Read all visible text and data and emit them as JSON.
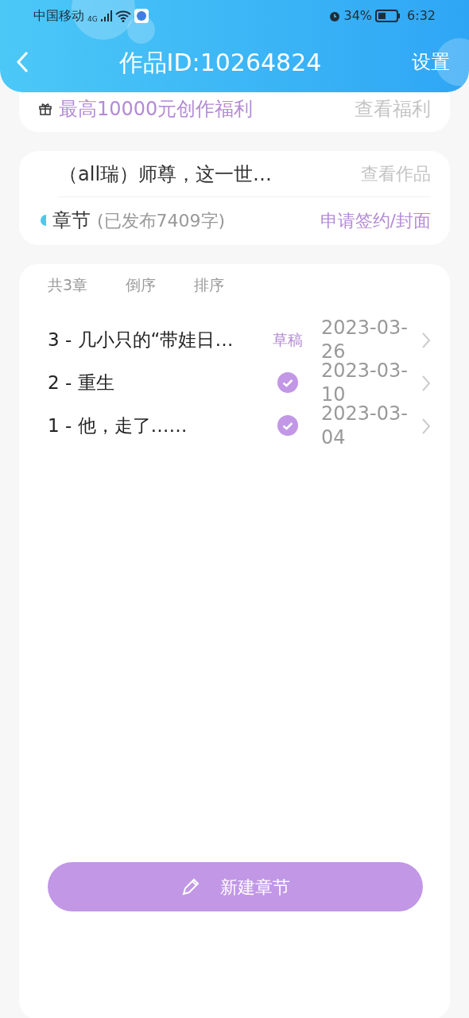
{
  "status_bar": {
    "carrier": "中国移动",
    "network": "4G",
    "battery": "34%",
    "time": "6:32"
  },
  "header": {
    "title": "作品ID:10264824",
    "action": "设置"
  },
  "benefit": {
    "text": "最高10000元创作福利",
    "link": "查看福利"
  },
  "work": {
    "title": "（all瑞）师尊，这一世…",
    "link": "查看作品",
    "section": "章节",
    "section_note": "(已发布7409字)",
    "apply": "申请签约/封面"
  },
  "toolbar": {
    "count": "共3章",
    "reverse": "倒序",
    "sort": "排序"
  },
  "chapters": [
    {
      "title": "3 - 几小只的“带娃日…",
      "kind": "draft",
      "status": "草稿",
      "date": "2023-03-26"
    },
    {
      "title": "2 - 重生",
      "kind": "published",
      "date": "2023-03-10"
    },
    {
      "title": "1 - 他，走了……",
      "kind": "published",
      "date": "2023-03-04"
    }
  ],
  "new_button": "新建章节"
}
